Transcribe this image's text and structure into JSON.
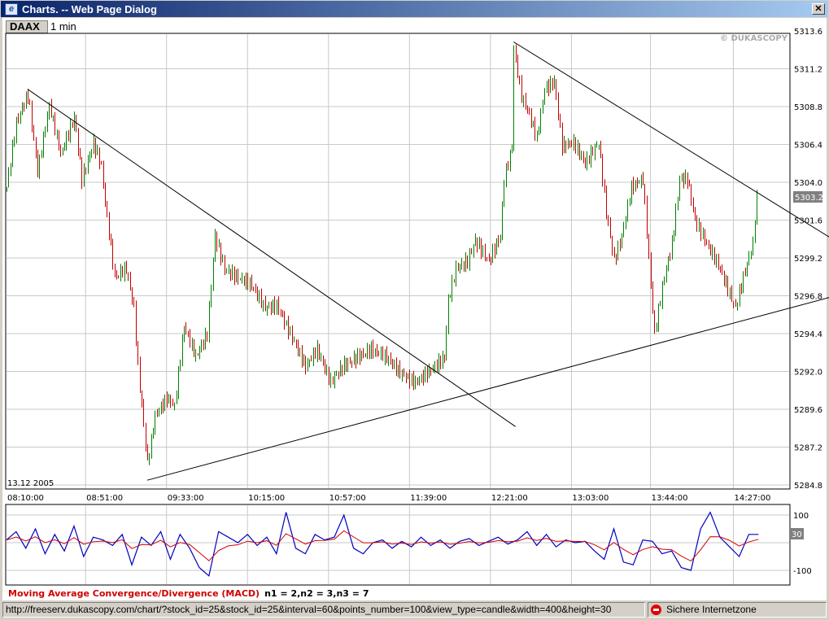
{
  "window": {
    "title": "Charts. -- Web Page Dialog",
    "close_label": "✕"
  },
  "toolbar": {
    "symbol": "DAAX",
    "interval": "1 min"
  },
  "chart": {
    "watermark": "© DUKASCOPY",
    "date_label": "13.12 2005",
    "current_price_label": "5303.2"
  },
  "chart_data": [
    {
      "type": "candlestick",
      "title": "DAAX 1 min",
      "ylim": [
        5284.8,
        5313.6
      ],
      "y_ticks": [
        "5313.6",
        "5311.2",
        "5308.8",
        "5306.4",
        "5304.0",
        "5301.6",
        "5299.2",
        "5296.8",
        "5294.4",
        "5292.0",
        "5289.6",
        "5287.2",
        "5284.8"
      ],
      "x_ticks": [
        "08:10:00",
        "08:51:00",
        "09:33:00",
        "10:15:00",
        "10:57:00",
        "11:39:00",
        "12:21:00",
        "13:03:00",
        "13:44:00",
        "14:27:00"
      ],
      "x_tick_minutes": [
        0,
        41,
        83,
        125,
        167,
        209,
        251,
        293,
        334,
        377
      ],
      "x_unit": "minutes since 08:10",
      "close_points": [
        [
          0,
          5303.7
        ],
        [
          5,
          5307.8
        ],
        [
          11,
          5309.6
        ],
        [
          16,
          5304.7
        ],
        [
          22,
          5308.9
        ],
        [
          28,
          5305.8
        ],
        [
          35,
          5308.1
        ],
        [
          39,
          5304.2
        ],
        [
          45,
          5306.5
        ],
        [
          49,
          5305.0
        ],
        [
          51,
          5302.7
        ],
        [
          56,
          5298.0
        ],
        [
          62,
          5298.5
        ],
        [
          66,
          5296.0
        ],
        [
          68,
          5292.3
        ],
        [
          73,
          5286.1
        ],
        [
          77,
          5289.2
        ],
        [
          83,
          5290.3
        ],
        [
          87,
          5289.8
        ],
        [
          92,
          5294.9
        ],
        [
          98,
          5292.9
        ],
        [
          104,
          5294.4
        ],
        [
          108,
          5300.6
        ],
        [
          113,
          5298.5
        ],
        [
          119,
          5298.0
        ],
        [
          127,
          5297.5
        ],
        [
          134,
          5296.0
        ],
        [
          140,
          5296.2
        ],
        [
          149,
          5293.9
        ],
        [
          155,
          5292.3
        ],
        [
          161,
          5293.4
        ],
        [
          168,
          5291.3
        ],
        [
          174,
          5292.3
        ],
        [
          182,
          5292.9
        ],
        [
          189,
          5293.4
        ],
        [
          197,
          5292.9
        ],
        [
          205,
          5291.8
        ],
        [
          212,
          5291.3
        ],
        [
          220,
          5292.1
        ],
        [
          227,
          5292.9
        ],
        [
          229,
          5296.5
        ],
        [
          233,
          5298.5
        ],
        [
          239,
          5299.0
        ],
        [
          243,
          5300.3
        ],
        [
          250,
          5299.0
        ],
        [
          256,
          5300.6
        ],
        [
          258,
          5304.2
        ],
        [
          262,
          5306.3
        ],
        [
          263,
          5312.5
        ],
        [
          267,
          5309.4
        ],
        [
          271,
          5308.3
        ],
        [
          275,
          5306.8
        ],
        [
          279,
          5309.9
        ],
        [
          284,
          5310.4
        ],
        [
          288,
          5306.3
        ],
        [
          294,
          5306.5
        ],
        [
          300,
          5305.2
        ],
        [
          307,
          5306.5
        ],
        [
          311,
          5302.1
        ],
        [
          315,
          5299.0
        ],
        [
          319,
          5300.6
        ],
        [
          324,
          5303.7
        ],
        [
          330,
          5304.2
        ],
        [
          334,
          5297.5
        ],
        [
          336,
          5294.4
        ],
        [
          341,
          5298.0
        ],
        [
          345,
          5300.1
        ],
        [
          349,
          5304.2
        ],
        [
          353,
          5304.2
        ],
        [
          357,
          5301.6
        ],
        [
          363,
          5300.1
        ],
        [
          370,
          5298.5
        ],
        [
          374,
          5297.2
        ],
        [
          378,
          5296.0
        ],
        [
          382,
          5298.0
        ],
        [
          387,
          5300.1
        ],
        [
          389,
          5303.2
        ]
      ],
      "trendlines": [
        [
          [
            11,
            5309.9
          ],
          [
            264,
            5288.5
          ]
        ],
        [
          [
            263,
            5312.9
          ],
          [
            427,
            5300.5
          ]
        ],
        [
          [
            73,
            5285.1
          ],
          [
            427,
            5296.7
          ]
        ]
      ],
      "colors": {
        "up": "#008000",
        "down": "#c00000"
      }
    },
    {
      "type": "line",
      "title": "Moving Average Convergence/Divergence (MACD)",
      "params": "n1 = 2,n2 = 3,n3 = 7",
      "ylim": [
        -140,
        120
      ],
      "y_ticks": [
        "100",
        "-100"
      ],
      "last_value_label": "30",
      "x_step_minutes": 5,
      "series": [
        {
          "name": "MACD",
          "color": "#0000c0",
          "values": [
            10,
            40,
            -20,
            50,
            -40,
            30,
            -30,
            60,
            -50,
            20,
            10,
            -10,
            30,
            -80,
            20,
            -10,
            40,
            -60,
            30,
            -20,
            -90,
            -120,
            40,
            20,
            0,
            30,
            -10,
            20,
            -40,
            110,
            -20,
            -40,
            30,
            10,
            20,
            100,
            -20,
            -40,
            0,
            10,
            -20,
            5,
            -15,
            20,
            -10,
            10,
            -20,
            5,
            15,
            -10,
            5,
            20,
            -5,
            10,
            40,
            -10,
            30,
            -15,
            10,
            0,
            5,
            -30,
            -60,
            50,
            -70,
            -80,
            10,
            5,
            -40,
            -30,
            -90,
            -100,
            50,
            110,
            20,
            -15,
            -50,
            30,
            30
          ]
        },
        {
          "name": "Signal",
          "color": "#d00000"
        }
      ]
    }
  ],
  "status": {
    "url": "http://freeserv.dukascopy.com/chart/?stock_id=25&stock_id=25&interval=60&points_number=100&view_type=candle&width=400&height=30",
    "zone": "Sichere Internetzone"
  }
}
